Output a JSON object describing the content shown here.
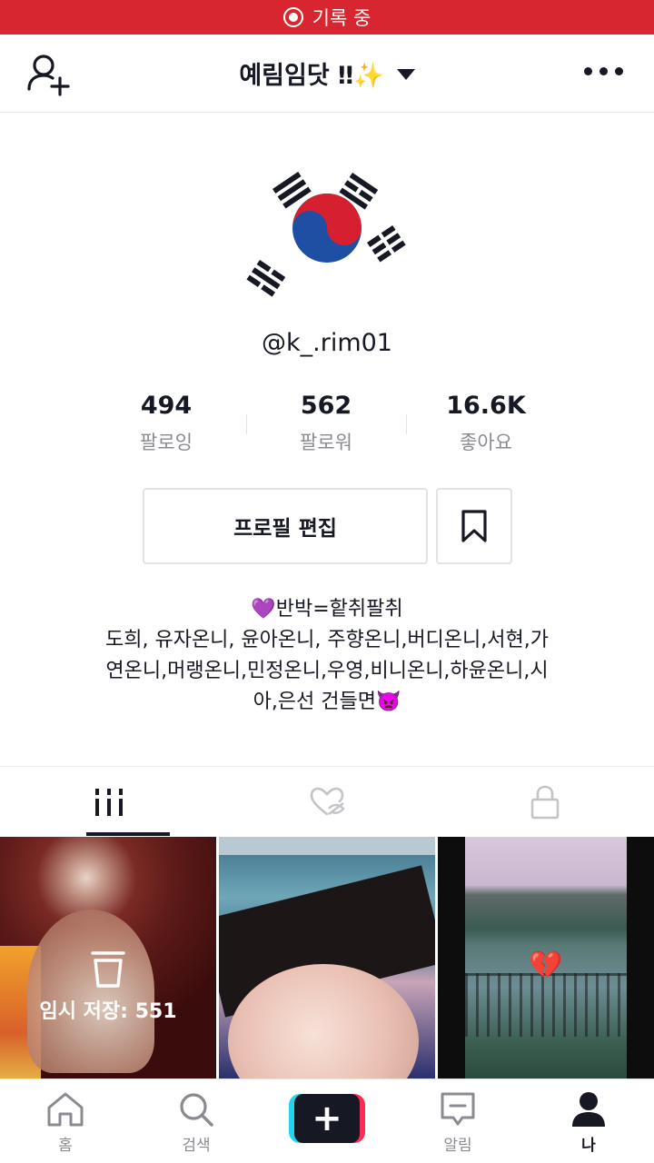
{
  "status_bar": {
    "recording_label": "기록 중",
    "color": "#d7262f"
  },
  "header": {
    "title": "예림임닷 ‼✨"
  },
  "profile": {
    "username": "@k_.rim01",
    "avatar_icon": "korea-flag-icon",
    "stats": [
      {
        "value": "494",
        "label": "팔로잉"
      },
      {
        "value": "562",
        "label": "팔로워"
      },
      {
        "value": "16.6K",
        "label": "좋아요"
      }
    ],
    "edit_profile_label": "프로필 편집",
    "bio_lines": [
      "💜반박=핱취팔취",
      "도희, 유자온니, 윤아온니, 주향온니,버디온니,서현,가",
      "연온니,머랭온니,민정온니,우영,비니온니,하윤온니,시",
      "아,은선 건들면👿"
    ]
  },
  "tabs": [
    {
      "icon": "videos-grid-icon",
      "active": true
    },
    {
      "icon": "liked-hidden-icon",
      "active": false
    },
    {
      "icon": "lock-icon",
      "active": false
    }
  ],
  "videos": [
    {
      "draft_label": "임시 저장: 551"
    },
    {},
    {
      "overlay_emoji": "💔"
    }
  ],
  "bottom_nav": [
    {
      "label": "홈",
      "icon": "home-icon"
    },
    {
      "label": "검색",
      "icon": "search-icon"
    },
    {
      "label": "",
      "icon": "create-plus-icon"
    },
    {
      "label": "알림",
      "icon": "inbox-icon"
    },
    {
      "label": "나",
      "icon": "profile-icon",
      "active": true
    }
  ]
}
